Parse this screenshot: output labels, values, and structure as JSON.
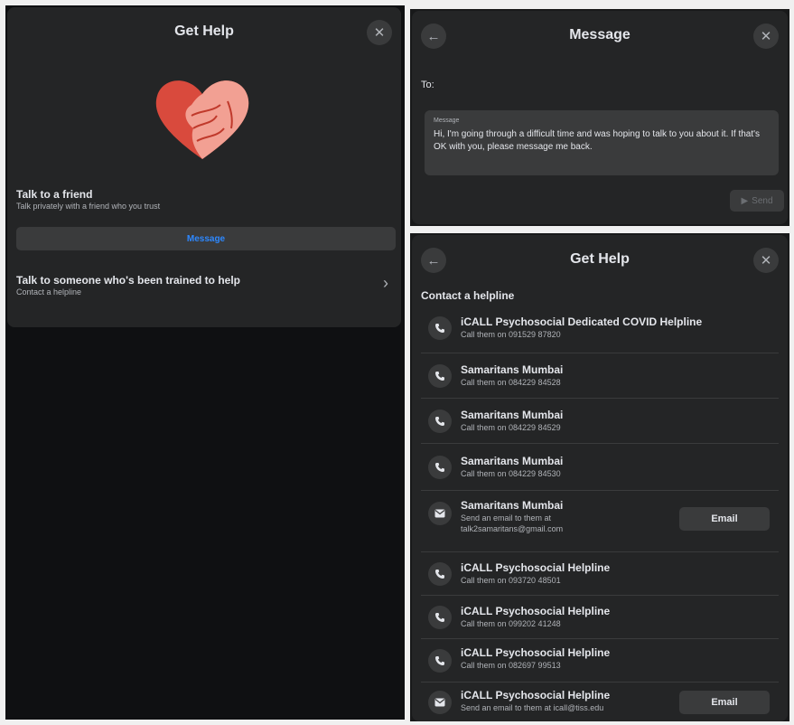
{
  "get_help_panel": {
    "title": "Get Help",
    "friend_title": "Talk to a friend",
    "friend_subtitle": "Talk privately with a friend who you trust",
    "message_button": "Message",
    "trained_title": "Talk to someone who's been trained to help",
    "trained_subtitle": "Contact a helpline"
  },
  "message_panel": {
    "title": "Message",
    "to_label": "To:",
    "message_label": "Message",
    "message_text": "Hi, I'm going through a difficult time and was hoping to talk to you about it. If that's OK with you, please message me back.",
    "send_label": "Send"
  },
  "helpline_panel": {
    "title": "Get Help",
    "section_title": "Contact a helpline",
    "items": [
      {
        "icon": "phone-icon",
        "name": "iCALL Psychosocial Dedicated COVID Helpline",
        "detail": "Call them on 091529 87820"
      },
      {
        "icon": "phone-icon",
        "name": "Samaritans Mumbai",
        "detail": "Call them on 084229 84528"
      },
      {
        "icon": "phone-icon",
        "name": "Samaritans Mumbai",
        "detail": "Call them on 084229 84529"
      },
      {
        "icon": "phone-icon",
        "name": "Samaritans Mumbai",
        "detail": "Call them on 084229 84530"
      },
      {
        "icon": "mail-icon",
        "name": "Samaritans Mumbai",
        "detail": "Send an email to them at talk2samaritans@gmail.com",
        "button": "Email"
      },
      {
        "icon": "phone-icon",
        "name": "iCALL Psychosocial Helpline",
        "detail": "Call them on 093720 48501"
      },
      {
        "icon": "phone-icon",
        "name": "iCALL Psychosocial Helpline",
        "detail": "Call them on 099202 41248"
      },
      {
        "icon": "phone-icon",
        "name": "iCALL Psychosocial Helpline",
        "detail": "Call them on 082697 99513"
      },
      {
        "icon": "mail-icon",
        "name": "iCALL Psychosocial Helpline",
        "detail": "Send an email to them at icall@tiss.edu",
        "button": "Email"
      }
    ]
  },
  "colors": {
    "background": "#18191a",
    "card": "#242526",
    "surface": "#3a3b3c",
    "text": "#e4e6eb",
    "muted": "#b0b3b8",
    "accent": "#2d88ff",
    "heart_dark": "#d94a3d",
    "heart_light": "#f2a093"
  }
}
